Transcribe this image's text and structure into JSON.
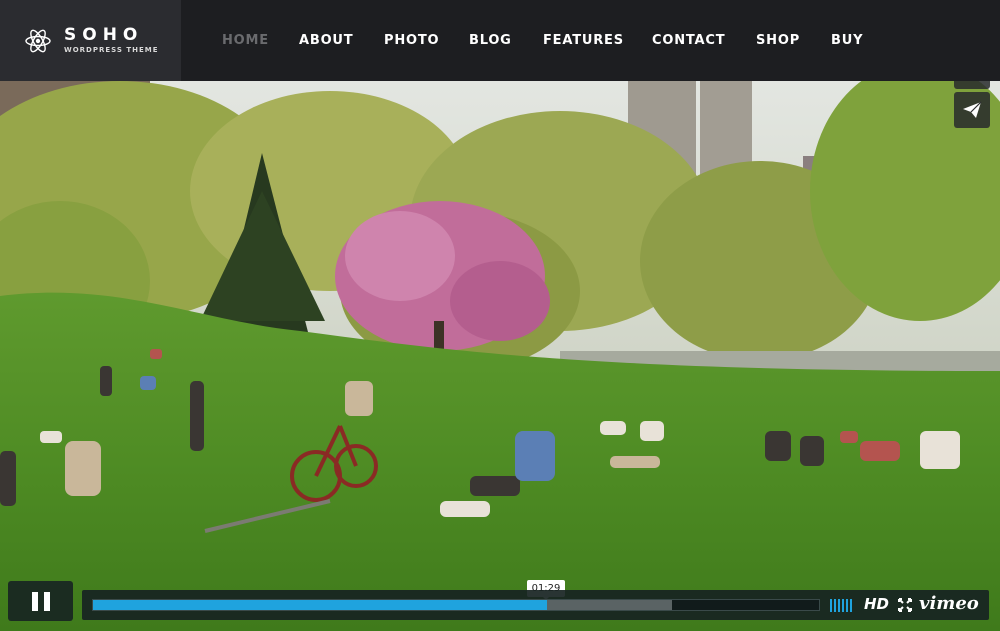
{
  "brand": {
    "name": "SOHO",
    "tagline": "WORDPRESS THEME"
  },
  "nav": {
    "items": [
      {
        "label": "HOME",
        "active": true
      },
      {
        "label": "ABOUT",
        "active": false
      },
      {
        "label": "PHOTO",
        "active": false
      },
      {
        "label": "BLOG",
        "active": false
      },
      {
        "label": "FEATURES",
        "active": false
      },
      {
        "label": "CONTACT",
        "active": false
      },
      {
        "label": "SHOP",
        "active": false
      },
      {
        "label": "BUY",
        "active": false
      }
    ]
  },
  "player": {
    "state": "playing",
    "timecode": "01:29",
    "progress_fraction": 0.626,
    "loaded_fraction": 0.797,
    "quality_label": "HD",
    "provider_label": "vimeo",
    "colors": {
      "accent": "#1fa3de",
      "control_bg": "#172322"
    }
  },
  "icons": {
    "logo": "atom-logo-icon",
    "send": "paper-plane-icon",
    "pause": "pause-icon",
    "volume": "volume-bars-icon",
    "fullscreen": "fullscreen-icon"
  }
}
